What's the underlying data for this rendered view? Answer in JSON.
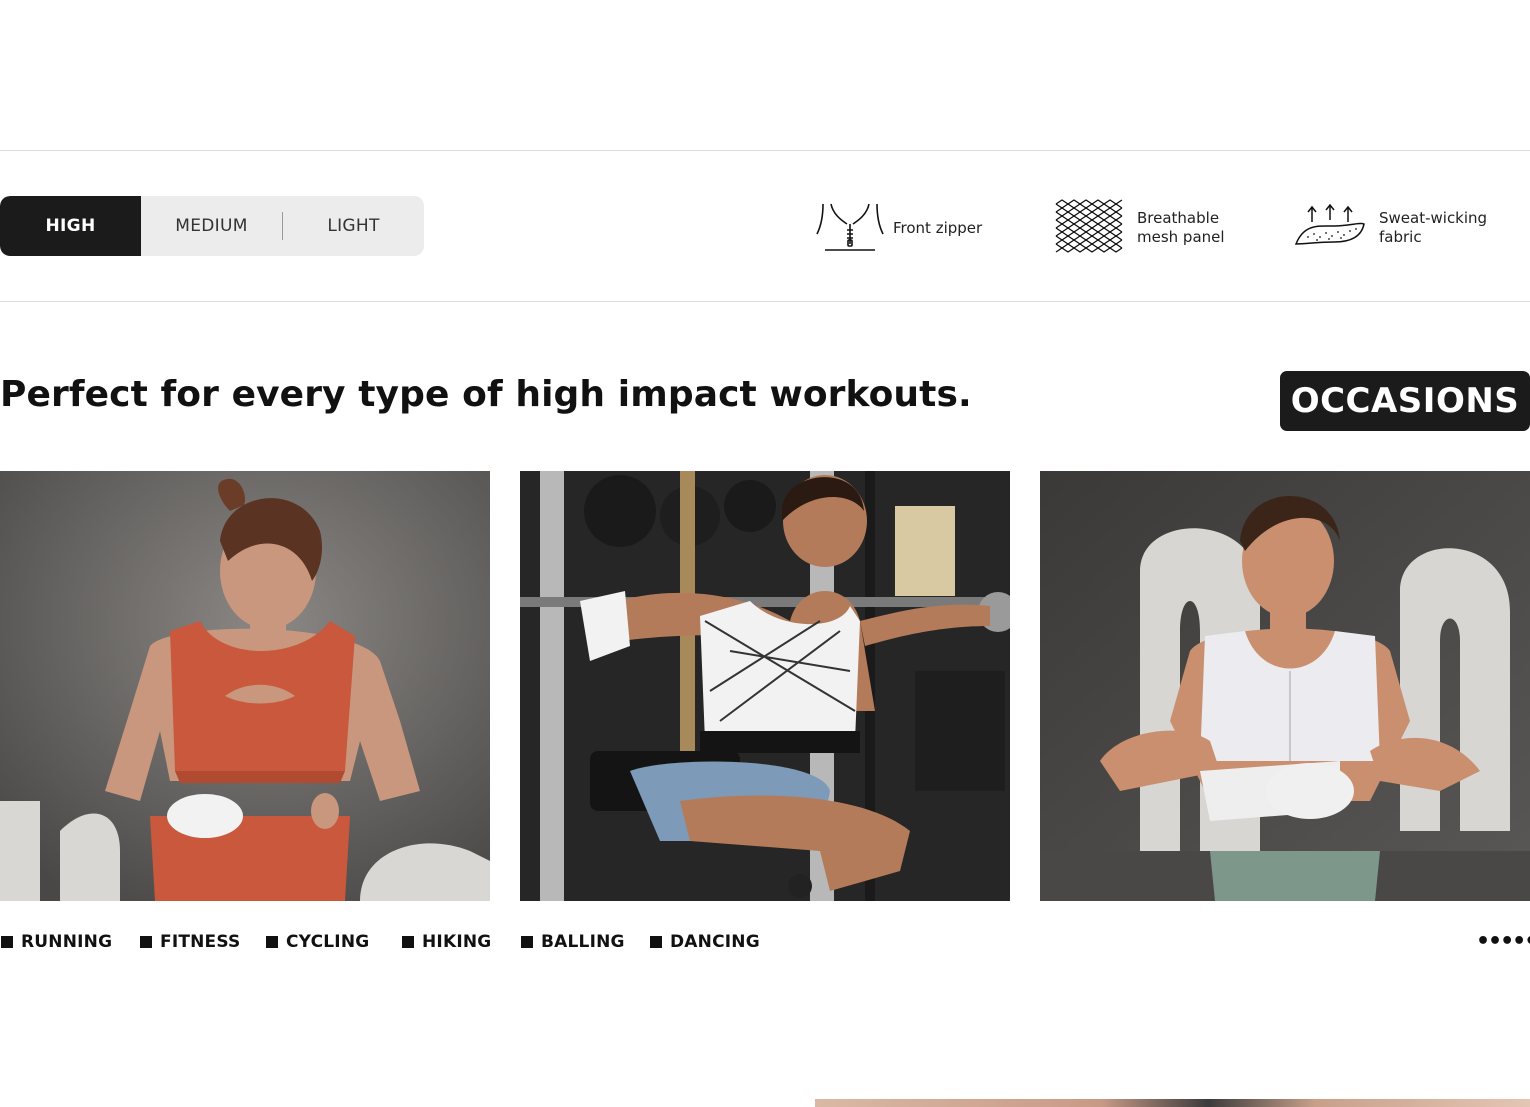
{
  "support_levels": {
    "options": [
      {
        "label": "HIGH",
        "selected": true
      },
      {
        "label": "MEDIUM",
        "selected": false
      },
      {
        "label": "LIGHT",
        "selected": false
      }
    ]
  },
  "features": [
    {
      "icon": "zipper-icon",
      "label": "Front zipper"
    },
    {
      "icon": "mesh-icon",
      "label": "Breathable\nmesh panel"
    },
    {
      "icon": "sweat-wicking-icon",
      "label": "Sweat-wicking\nfabric"
    }
  ],
  "headline": "Perfect for every type of high impact workouts.",
  "occasions_badge": "OCCASIONS",
  "photos": [
    {
      "description": "woman-in-orange-sports-bra"
    },
    {
      "description": "woman-squatting-with-barbell"
    },
    {
      "description": "woman-in-white-sports-bra"
    }
  ],
  "activities": [
    "RUNNING",
    "FITNESS",
    "CYCLING",
    "HIKING",
    "BALLING",
    "DANCING"
  ],
  "more_indicator": "••••••",
  "colors": {
    "accent_dark": "#1b1b1b",
    "segment_bg": "#ececec"
  }
}
